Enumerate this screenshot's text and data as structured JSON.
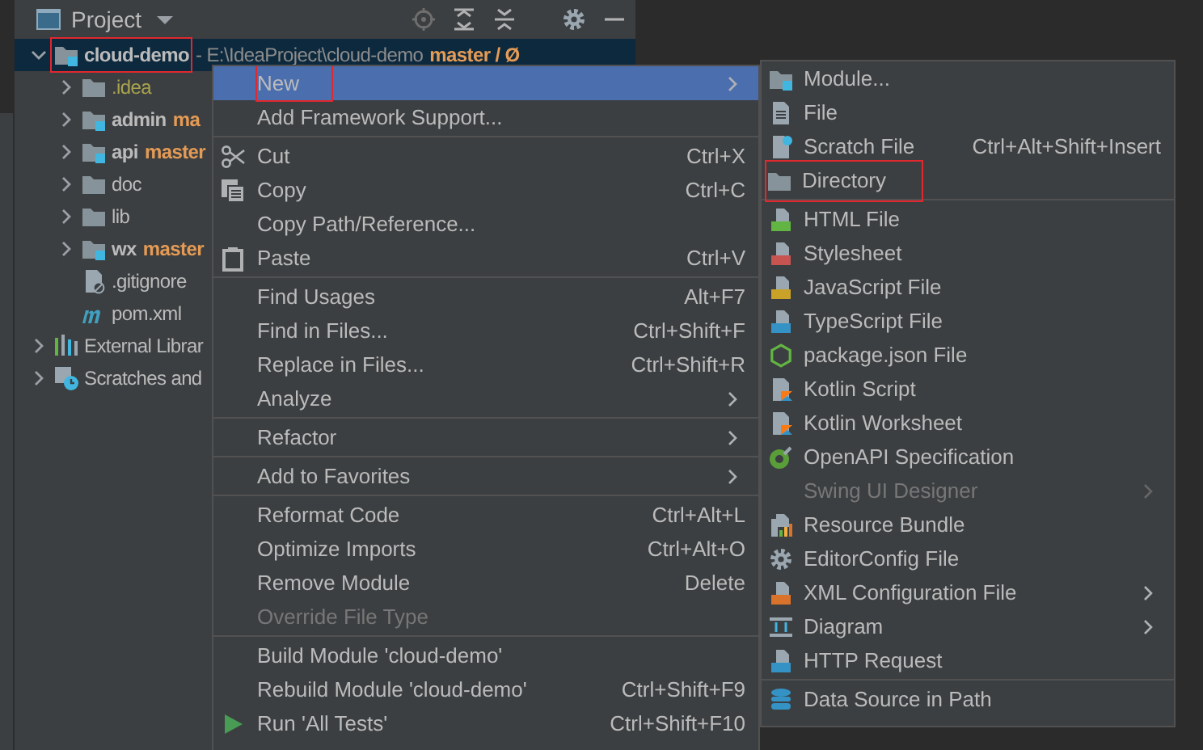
{
  "panel": {
    "title": "Project"
  },
  "tree": [
    {
      "label": "cloud-demo",
      "kind": "module",
      "path": "- E:\\IdeaProject\\cloud-demo",
      "branch": "master / Ø",
      "expanded": true,
      "selected": true,
      "annotated": true,
      "ignored": false,
      "children": [
        {
          "label": ".idea",
          "kind": "folder",
          "expanded": false,
          "selected": false,
          "annotated": false,
          "ignored": true
        },
        {
          "label": "admin",
          "kind": "module",
          "branch": "ma",
          "expanded": false,
          "selected": false,
          "annotated": false,
          "ignored": false
        },
        {
          "label": "api",
          "kind": "module",
          "branch": "master",
          "expanded": false,
          "selected": false,
          "annotated": false,
          "ignored": false
        },
        {
          "label": "doc",
          "kind": "folder",
          "expanded": false,
          "selected": false,
          "annotated": false,
          "ignored": false
        },
        {
          "label": "lib",
          "kind": "folder",
          "expanded": false,
          "selected": false,
          "annotated": false,
          "ignored": false
        },
        {
          "label": "wx",
          "kind": "module",
          "branch": "master",
          "expanded": false,
          "selected": false,
          "annotated": false,
          "ignored": false
        },
        {
          "label": ".gitignore",
          "kind": "gitignore",
          "selected": false,
          "annotated": false,
          "ignored": false
        },
        {
          "label": "pom.xml",
          "kind": "maven",
          "selected": false,
          "annotated": false,
          "ignored": false
        }
      ]
    },
    {
      "label": "External Librar",
      "kind": "libraries",
      "expanded": false,
      "selected": false,
      "annotated": false,
      "ignored": false
    },
    {
      "label": "Scratches and",
      "kind": "scratches",
      "expanded": false,
      "selected": false,
      "annotated": false,
      "ignored": false
    }
  ],
  "context_menu": [
    {
      "label": "New",
      "kind": "plain",
      "submenu": true,
      "disabled": false,
      "selected": true,
      "annotated": true
    },
    {
      "label": "Add Framework Support...",
      "kind": "plain",
      "submenu": false,
      "disabled": false,
      "selected": false,
      "annotated": false
    },
    {
      "kind": "separator"
    },
    {
      "label": "Cut",
      "shortcut": "Ctrl+X",
      "kind": "cut",
      "submenu": false,
      "disabled": false,
      "selected": false,
      "annotated": false
    },
    {
      "label": "Copy",
      "shortcut": "Ctrl+C",
      "kind": "copy",
      "submenu": false,
      "disabled": false,
      "selected": false,
      "annotated": false
    },
    {
      "label": "Copy Path/Reference...",
      "kind": "plain",
      "submenu": false,
      "disabled": false,
      "selected": false,
      "annotated": false
    },
    {
      "label": "Paste",
      "shortcut": "Ctrl+V",
      "kind": "paste",
      "submenu": false,
      "disabled": false,
      "selected": false,
      "annotated": false
    },
    {
      "kind": "separator"
    },
    {
      "label": "Find Usages",
      "shortcut": "Alt+F7",
      "kind": "plain",
      "submenu": false,
      "disabled": false,
      "selected": false,
      "annotated": false
    },
    {
      "label": "Find in Files...",
      "shortcut": "Ctrl+Shift+F",
      "kind": "plain",
      "submenu": false,
      "disabled": false,
      "selected": false,
      "annotated": false
    },
    {
      "label": "Replace in Files...",
      "shortcut": "Ctrl+Shift+R",
      "kind": "plain",
      "submenu": false,
      "disabled": false,
      "selected": false,
      "annotated": false
    },
    {
      "label": "Analyze",
      "kind": "plain",
      "submenu": true,
      "disabled": false,
      "selected": false,
      "annotated": false
    },
    {
      "kind": "separator"
    },
    {
      "label": "Refactor",
      "kind": "plain",
      "submenu": true,
      "disabled": false,
      "selected": false,
      "annotated": false
    },
    {
      "kind": "separator"
    },
    {
      "label": "Add to Favorites",
      "kind": "plain",
      "submenu": true,
      "disabled": false,
      "selected": false,
      "annotated": false
    },
    {
      "kind": "separator"
    },
    {
      "label": "Reformat Code",
      "shortcut": "Ctrl+Alt+L",
      "kind": "plain",
      "submenu": false,
      "disabled": false,
      "selected": false,
      "annotated": false
    },
    {
      "label": "Optimize Imports",
      "shortcut": "Ctrl+Alt+O",
      "kind": "plain",
      "submenu": false,
      "disabled": false,
      "selected": false,
      "annotated": false
    },
    {
      "label": "Remove Module",
      "shortcut": "Delete",
      "kind": "plain",
      "submenu": false,
      "disabled": false,
      "selected": false,
      "annotated": false
    },
    {
      "label": "Override File Type",
      "kind": "plain",
      "submenu": false,
      "disabled": true,
      "selected": false,
      "annotated": false
    },
    {
      "kind": "separator"
    },
    {
      "label": "Build Module 'cloud-demo'",
      "kind": "plain",
      "submenu": false,
      "disabled": false,
      "selected": false,
      "annotated": false
    },
    {
      "label": "Rebuild Module 'cloud-demo'",
      "shortcut": "Ctrl+Shift+F9",
      "kind": "plain",
      "submenu": false,
      "disabled": false,
      "selected": false,
      "annotated": false
    },
    {
      "label": "Run 'All Tests'",
      "shortcut": "Ctrl+Shift+F10",
      "kind": "run",
      "submenu": false,
      "disabled": false,
      "selected": false,
      "annotated": false
    }
  ],
  "new_submenu": [
    {
      "label": "Module...",
      "kind": "module",
      "submenu": false,
      "disabled": false,
      "selected": false,
      "annotated": false
    },
    {
      "label": "File",
      "kind": "file",
      "submenu": false,
      "disabled": false,
      "selected": false,
      "annotated": false
    },
    {
      "label": "Scratch File",
      "shortcut": "Ctrl+Alt+Shift+Insert",
      "kind": "scratch",
      "submenu": false,
      "disabled": false,
      "selected": false,
      "annotated": false
    },
    {
      "label": "Directory",
      "kind": "folder",
      "submenu": false,
      "disabled": false,
      "selected": false,
      "annotated": true
    },
    {
      "kind": "separator"
    },
    {
      "label": "HTML File",
      "kind": "html",
      "submenu": false,
      "disabled": false,
      "selected": false,
      "annotated": false
    },
    {
      "label": "Stylesheet",
      "kind": "css",
      "submenu": false,
      "disabled": false,
      "selected": false,
      "annotated": false
    },
    {
      "label": "JavaScript File",
      "kind": "js",
      "submenu": false,
      "disabled": false,
      "selected": false,
      "annotated": false
    },
    {
      "label": "TypeScript File",
      "kind": "ts",
      "submenu": false,
      "disabled": false,
      "selected": false,
      "annotated": false
    },
    {
      "label": "package.json File",
      "kind": "npm",
      "submenu": false,
      "disabled": false,
      "selected": false,
      "annotated": false
    },
    {
      "label": "Kotlin Script",
      "kind": "kotlin",
      "submenu": false,
      "disabled": false,
      "selected": false,
      "annotated": false
    },
    {
      "label": "Kotlin Worksheet",
      "kind": "kotlin",
      "submenu": false,
      "disabled": false,
      "selected": false,
      "annotated": false
    },
    {
      "label": "OpenAPI Specification",
      "kind": "openapi",
      "submenu": false,
      "disabled": false,
      "selected": false,
      "annotated": false
    },
    {
      "label": "Swing UI Designer",
      "kind": "plain",
      "submenu": true,
      "disabled": true,
      "selected": false,
      "annotated": false
    },
    {
      "label": "Resource Bundle",
      "kind": "bundle",
      "submenu": false,
      "disabled": false,
      "selected": false,
      "annotated": false
    },
    {
      "label": "EditorConfig File",
      "kind": "gear",
      "submenu": false,
      "disabled": false,
      "selected": false,
      "annotated": false
    },
    {
      "label": "XML Configuration File",
      "kind": "xml",
      "submenu": true,
      "disabled": false,
      "selected": false,
      "annotated": false
    },
    {
      "label": "Diagram",
      "kind": "diagram",
      "submenu": true,
      "disabled": false,
      "selected": false,
      "annotated": false
    },
    {
      "label": "HTTP Request",
      "kind": "api",
      "submenu": false,
      "disabled": false,
      "selected": false,
      "annotated": false
    },
    {
      "kind": "separator"
    },
    {
      "label": "Data Source in Path",
      "kind": "database",
      "submenu": false,
      "disabled": false,
      "selected": false,
      "annotated": false
    }
  ]
}
